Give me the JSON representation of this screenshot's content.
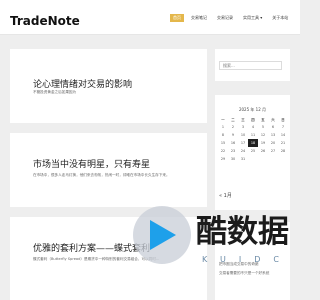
{
  "header": {
    "site_title": "TradeNote",
    "nav": [
      {
        "label": "首页",
        "active": true
      },
      {
        "label": "交易笔记",
        "active": false
      },
      {
        "label": "交易记录",
        "active": false
      },
      {
        "label": "实用工具 ▾",
        "active": false
      },
      {
        "label": "关于本站",
        "active": false
      }
    ]
  },
  "posts": [
    {
      "title": "论心理情绪对交易的影响",
      "excerpt": "不管投资黄金之后如果因为"
    },
    {
      "title": "市场当中没有明星，只有寿星",
      "excerpt": "在市场中，很多人走马灯换，他们来去匆匆，热闹一时，却难在市场中长久生存下来。"
    },
    {
      "title": "优雅的套利方案——蝶式套利",
      "excerpt": "蝶式套利（Butterfly Spread）是期货中一种特别的套利交易组合，可以同时..."
    }
  ],
  "sidebar": {
    "search_placeholder": "搜索...",
    "calendar": {
      "caption": "2025 年 12 月",
      "weekdays": [
        "一",
        "二",
        "三",
        "四",
        "五",
        "六",
        "日"
      ],
      "weeks": [
        [
          "1",
          "2",
          "3",
          "4",
          "5",
          "6",
          "7"
        ],
        [
          "8",
          "9",
          "10",
          "11",
          "12",
          "13",
          "14"
        ],
        [
          "15",
          "16",
          "17",
          "18",
          "19",
          "20",
          "21"
        ],
        [
          "22",
          "23",
          "24",
          "25",
          "26",
          "27",
          "28"
        ],
        [
          "29",
          "30",
          "31",
          "",
          "",
          "",
          ""
        ]
      ],
      "today": "18",
      "prev_link": "« 1月"
    },
    "recent_posts": [
      "把币圈当成交易中的奇葩",
      "交易者需要的不只是一个好系统"
    ]
  },
  "watermark": {
    "text": "酷数据",
    "sub": "KUIDC"
  }
}
